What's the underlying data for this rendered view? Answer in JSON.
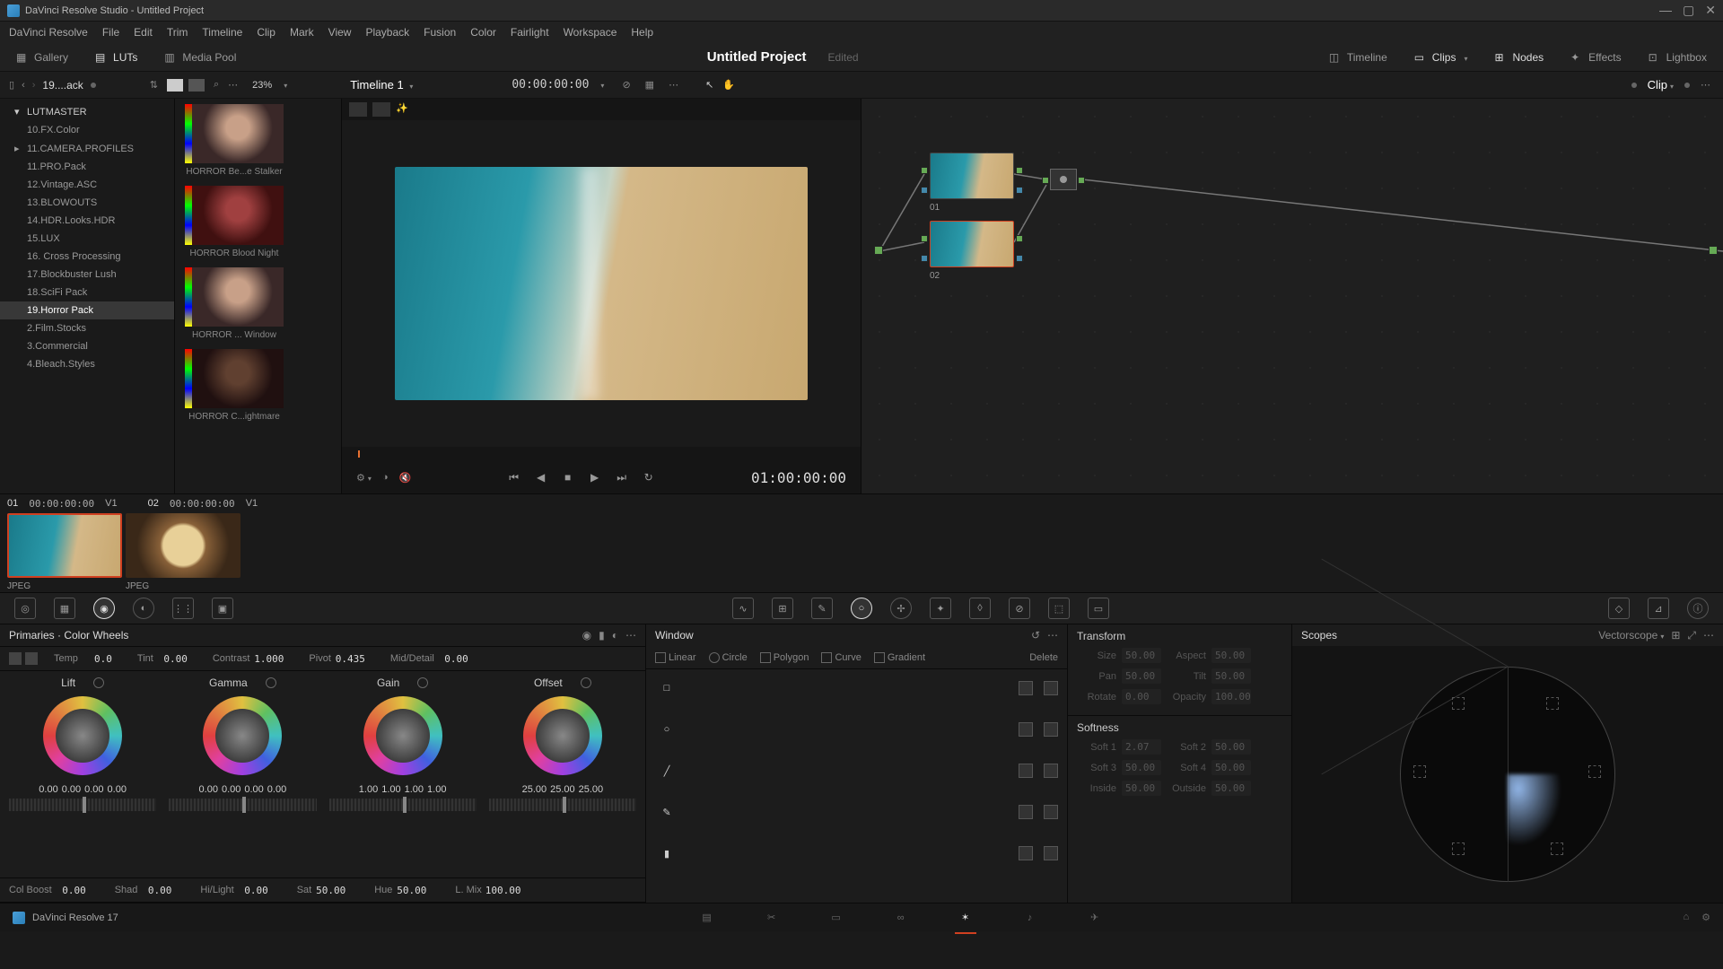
{
  "titlebar": {
    "title": "DaVinci Resolve Studio - Untitled Project"
  },
  "menu": [
    "DaVinci Resolve",
    "File",
    "Edit",
    "Trim",
    "Timeline",
    "Clip",
    "Mark",
    "View",
    "Playback",
    "Fusion",
    "Color",
    "Fairlight",
    "Workspace",
    "Help"
  ],
  "toolbar": {
    "gallery": "Gallery",
    "luts": "LUTs",
    "mediapool": "Media Pool",
    "project": "Untitled Project",
    "edited": "Edited",
    "timeline": "Timeline",
    "clips": "Clips",
    "nodes": "Nodes",
    "effects": "Effects",
    "lightbox": "Lightbox"
  },
  "subheader": {
    "breadcrumb": "19....ack",
    "zoom": "23%",
    "timeline_name": "Timeline 1",
    "timecode": "00:00:00:00",
    "clip_mode": "Clip"
  },
  "lut_tree": {
    "root": "LUTMASTER",
    "items": [
      "10.FX.Color",
      "11.CAMERA.PROFILES",
      "11.PRO.Pack",
      "12.Vintage.ASC",
      "13.BLOWOUTS",
      "14.HDR.Looks.HDR",
      "15.LUX",
      "16. Cross Processing",
      "17.Blockbuster Lush",
      "18.SciFi Pack",
      "19.Horror Pack",
      "2.Film.Stocks",
      "3.Commercial",
      "4.Bleach.Styles"
    ],
    "selected_index": 10
  },
  "lut_previews": [
    "HORROR Be...e Stalker",
    "HORROR Blood Night",
    "HORROR ... Window",
    "HORROR C...ightmare"
  ],
  "viewer": {
    "timecode": "01:00:00:00"
  },
  "nodes": {
    "n1": "01",
    "n2": "02"
  },
  "clips": [
    {
      "num": "01",
      "tc": "00:00:00:00",
      "track": "V1",
      "type": "JPEG"
    },
    {
      "num": "02",
      "tc": "00:00:00:00",
      "track": "V1",
      "type": "JPEG"
    }
  ],
  "primaries": {
    "title": "Primaries · Color Wheels",
    "params_top": {
      "temp_l": "Temp",
      "temp": "0.0",
      "tint_l": "Tint",
      "tint": "0.00",
      "contrast_l": "Contrast",
      "contrast": "1.000",
      "pivot_l": "Pivot",
      "pivot": "0.435",
      "middetail_l": "Mid/Detail",
      "middetail": "0.00"
    },
    "wheels": {
      "lift": {
        "name": "Lift",
        "v": [
          "0.00",
          "0.00",
          "0.00",
          "0.00"
        ]
      },
      "gamma": {
        "name": "Gamma",
        "v": [
          "0.00",
          "0.00",
          "0.00",
          "0.00"
        ]
      },
      "gain": {
        "name": "Gain",
        "v": [
          "1.00",
          "1.00",
          "1.00",
          "1.00"
        ]
      },
      "offset": {
        "name": "Offset",
        "v": [
          "25.00",
          "25.00",
          "25.00"
        ]
      }
    },
    "params_bot": {
      "colboost_l": "Col Boost",
      "colboost": "0.00",
      "shad_l": "Shad",
      "shad": "0.00",
      "hilight_l": "Hi/Light",
      "hilight": "0.00",
      "sat_l": "Sat",
      "sat": "50.00",
      "hue_l": "Hue",
      "hue": "50.00",
      "lmix_l": "L. Mix",
      "lmix": "100.00"
    }
  },
  "window": {
    "title": "Window",
    "tools": [
      "Linear",
      "Circle",
      "Polygon",
      "Curve",
      "Gradient",
      "Delete"
    ]
  },
  "transform": {
    "title": "Transform",
    "size_l": "Size",
    "size": "50.00",
    "aspect_l": "Aspect",
    "aspect": "50.00",
    "pan_l": "Pan",
    "pan": "50.00",
    "tilt_l": "Tilt",
    "tilt": "50.00",
    "rotate_l": "Rotate",
    "rotate": "0.00",
    "opacity_l": "Opacity",
    "opacity": "100.00",
    "soft_title": "Softness",
    "s1_l": "Soft 1",
    "s1": "2.07",
    "s2_l": "Soft 2",
    "s2": "50.00",
    "s3_l": "Soft 3",
    "s3": "50.00",
    "s4_l": "Soft 4",
    "s4": "50.00",
    "in_l": "Inside",
    "in": "50.00",
    "out_l": "Outside",
    "out": "50.00"
  },
  "scopes": {
    "title": "Scopes",
    "type": "Vectorscope"
  },
  "footer": {
    "version": "DaVinci Resolve 17"
  }
}
